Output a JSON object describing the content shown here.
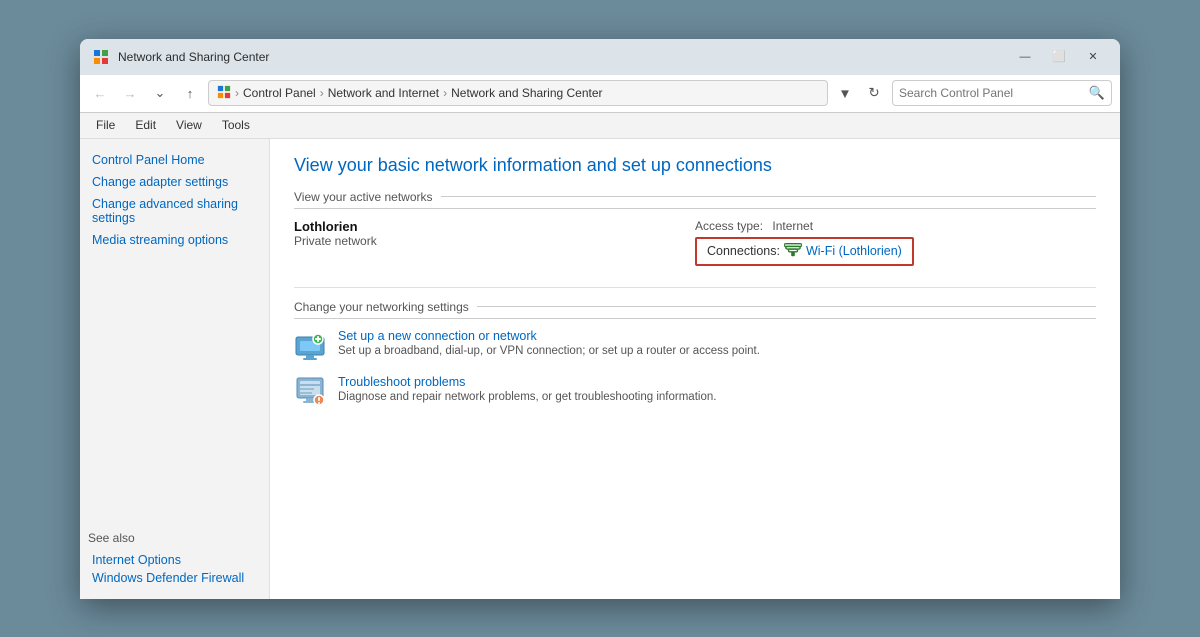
{
  "window": {
    "title": "Network and Sharing Center",
    "minimize_label": "—",
    "maximize_label": "⬜",
    "close_label": "✕"
  },
  "addressbar": {
    "back_tooltip": "Back",
    "forward_tooltip": "Forward",
    "recent_tooltip": "Recent locations",
    "up_tooltip": "Up",
    "path": {
      "icon": "control-panel-icon",
      "segment1": "Control Panel",
      "sep1": "›",
      "segment2": "Network and Internet",
      "sep2": "›",
      "segment3": "Network and Sharing Center"
    },
    "chevron_label": "▾",
    "refresh_label": "↻",
    "search_placeholder": "Search Control Panel",
    "search_icon": "🔍"
  },
  "menubar": {
    "items": [
      "File",
      "Edit",
      "View",
      "Tools"
    ]
  },
  "sidebar": {
    "links": [
      "Control Panel Home",
      "Change adapter settings",
      "Change advanced sharing settings",
      "Media streaming options"
    ],
    "see_also_label": "See also",
    "see_also_links": [
      "Internet Options",
      "Windows Defender Firewall"
    ]
  },
  "main": {
    "title": "View your basic network information and set up connections",
    "active_networks_label": "View your active networks",
    "network_name": "Lothlorien",
    "network_type": "Private network",
    "access_type_label": "Access type:",
    "access_type_value": "Internet",
    "connections_label": "Connections:",
    "connections_wifi_icon": "📶",
    "connections_link": "Wi-Fi (Lothlorien)",
    "networking_settings_label": "Change your networking settings",
    "items": [
      {
        "title": "Set up a new connection or network",
        "desc": "Set up a broadband, dial-up, or VPN connection; or set up a router or access point."
      },
      {
        "title": "Troubleshoot problems",
        "desc": "Diagnose and repair network problems, or get troubleshooting information."
      }
    ]
  }
}
